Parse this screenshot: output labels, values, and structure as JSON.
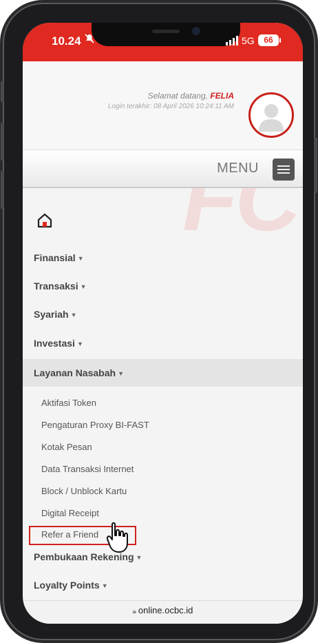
{
  "status_bar": {
    "time": "10.24",
    "network": "5G",
    "battery": "66"
  },
  "header": {
    "welcome_prefix": "Selamat datang, ",
    "user_name": "FELIA",
    "last_login": "Login terakhir: 08 April 2026 10:24:11 AM"
  },
  "menu_bar": {
    "label": "MENU"
  },
  "watermark": "FC",
  "nav": {
    "items": [
      {
        "label": "Finansial"
      },
      {
        "label": "Transaksi"
      },
      {
        "label": "Syariah"
      },
      {
        "label": "Investasi"
      },
      {
        "label": "Layanan Nasabah"
      }
    ],
    "sub_items": [
      {
        "label": "Aktifasi Token"
      },
      {
        "label": "Pengaturan Proxy BI-FAST"
      },
      {
        "label": "Kotak Pesan"
      },
      {
        "label": "Data Transaksi Internet"
      },
      {
        "label": "Block / Unblock Kartu"
      },
      {
        "label": "Digital Receipt"
      },
      {
        "label": "Refer a Friend"
      }
    ],
    "bottom_items": [
      {
        "label": "Pembukaan Rekening"
      },
      {
        "label": "Loyalty Points"
      }
    ]
  },
  "url_bar": {
    "url": "online.ocbc.id"
  },
  "colors": {
    "brand_red": "#e02920",
    "highlight_red": "#d0201c"
  }
}
